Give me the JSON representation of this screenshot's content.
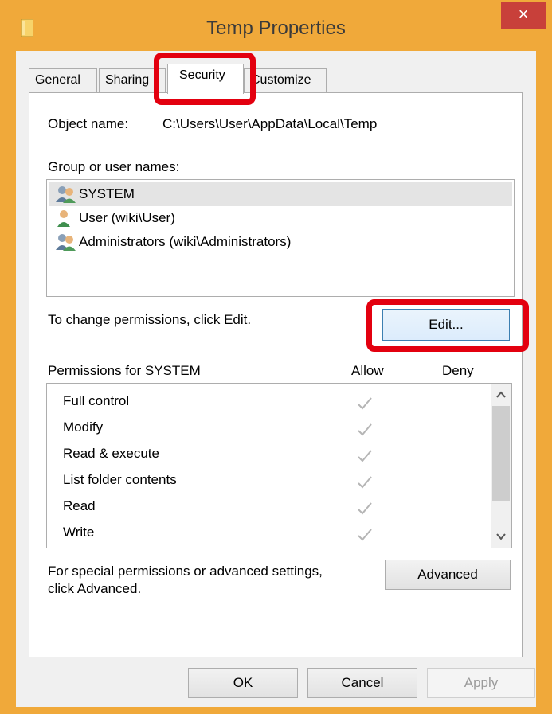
{
  "window": {
    "title": "Temp Properties",
    "close_label": "×"
  },
  "tabs": [
    {
      "label": "General"
    },
    {
      "label": "Sharing"
    },
    {
      "label": "Security"
    },
    {
      "label": "Customize"
    }
  ],
  "security": {
    "object_name_label": "Object name:",
    "object_name_value": "C:\\Users\\User\\AppData\\Local\\Temp",
    "group_label": "Group or user names:",
    "users": [
      {
        "name": "SYSTEM",
        "selected": true,
        "icon": "user-group-icon"
      },
      {
        "name": "User (wiki\\User)",
        "selected": false,
        "icon": "user-icon"
      },
      {
        "name": "Administrators (wiki\\Administrators)",
        "selected": false,
        "icon": "user-group-icon"
      }
    ],
    "change_text": "To change permissions, click Edit.",
    "edit_label": "Edit...",
    "permissions_header": "Permissions for SYSTEM",
    "allow_header": "Allow",
    "deny_header": "Deny",
    "permissions": [
      {
        "name": "Full control",
        "allow": true,
        "deny": false
      },
      {
        "name": "Modify",
        "allow": true,
        "deny": false
      },
      {
        "name": "Read & execute",
        "allow": true,
        "deny": false
      },
      {
        "name": "List folder contents",
        "allow": true,
        "deny": false
      },
      {
        "name": "Read",
        "allow": true,
        "deny": false
      },
      {
        "name": "Write",
        "allow": true,
        "deny": false
      }
    ],
    "advanced_text_line1": "For special permissions or advanced settings,",
    "advanced_text_line2": "click Advanced.",
    "advanced_label": "Advanced"
  },
  "footer": {
    "ok_label": "OK",
    "cancel_label": "Cancel",
    "apply_label": "Apply"
  },
  "colors": {
    "title_bar": "#f0a93a",
    "close_button": "#c8403a",
    "highlight": "#e3000f"
  }
}
